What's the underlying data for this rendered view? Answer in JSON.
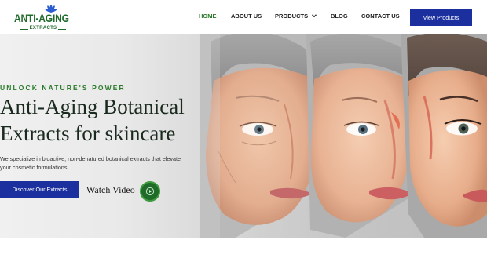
{
  "logo": {
    "title": "ANTI-AGING",
    "subtitle": "EXTRACTS",
    "icon": "lotus-flower-icon"
  },
  "nav": {
    "home": "HOME",
    "about": "ABOUT US",
    "products": "PRODUCTS",
    "blog": "BLOG",
    "contact": "CONTACT US",
    "active_item": "HOME"
  },
  "header": {
    "view_products_label": "View Products"
  },
  "hero": {
    "eyebrow": "UNLOCK NATURE'S POWER",
    "headline_line1": "Anti-Aging Botanical",
    "headline_line2": "Extracts for skincare",
    "description": "We specialize in bioactive, non-denatured botanical extracts that elevate your cosmetic formulations",
    "cta_label": "Discover Our Extracts",
    "watch_label": "Watch Video"
  },
  "colors": {
    "brand_green": "#1f6b2a",
    "button_blue": "#1b2f9e",
    "nav_active": "#2a7a2a"
  }
}
